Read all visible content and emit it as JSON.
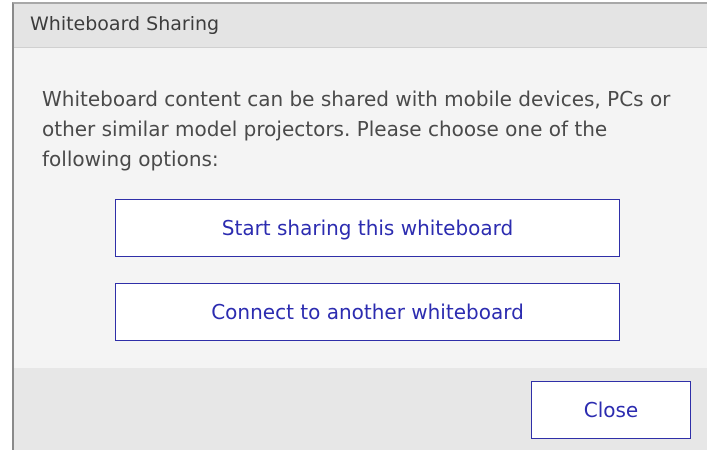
{
  "dialog": {
    "title": "Whiteboard Sharing",
    "message": "Whiteboard content can be shared with mobile devices, PCs or other similar model projectors. Please choose one of the following options:",
    "options": [
      {
        "label": "Start sharing this whiteboard"
      },
      {
        "label": "Connect to another whiteboard"
      }
    ],
    "close_label": "Close"
  },
  "colors": {
    "accent": "#2c2cb0",
    "dialog_background": "#f4f4f4",
    "title_bar": "#e4e4e4",
    "footer": "#e7e7e7"
  }
}
